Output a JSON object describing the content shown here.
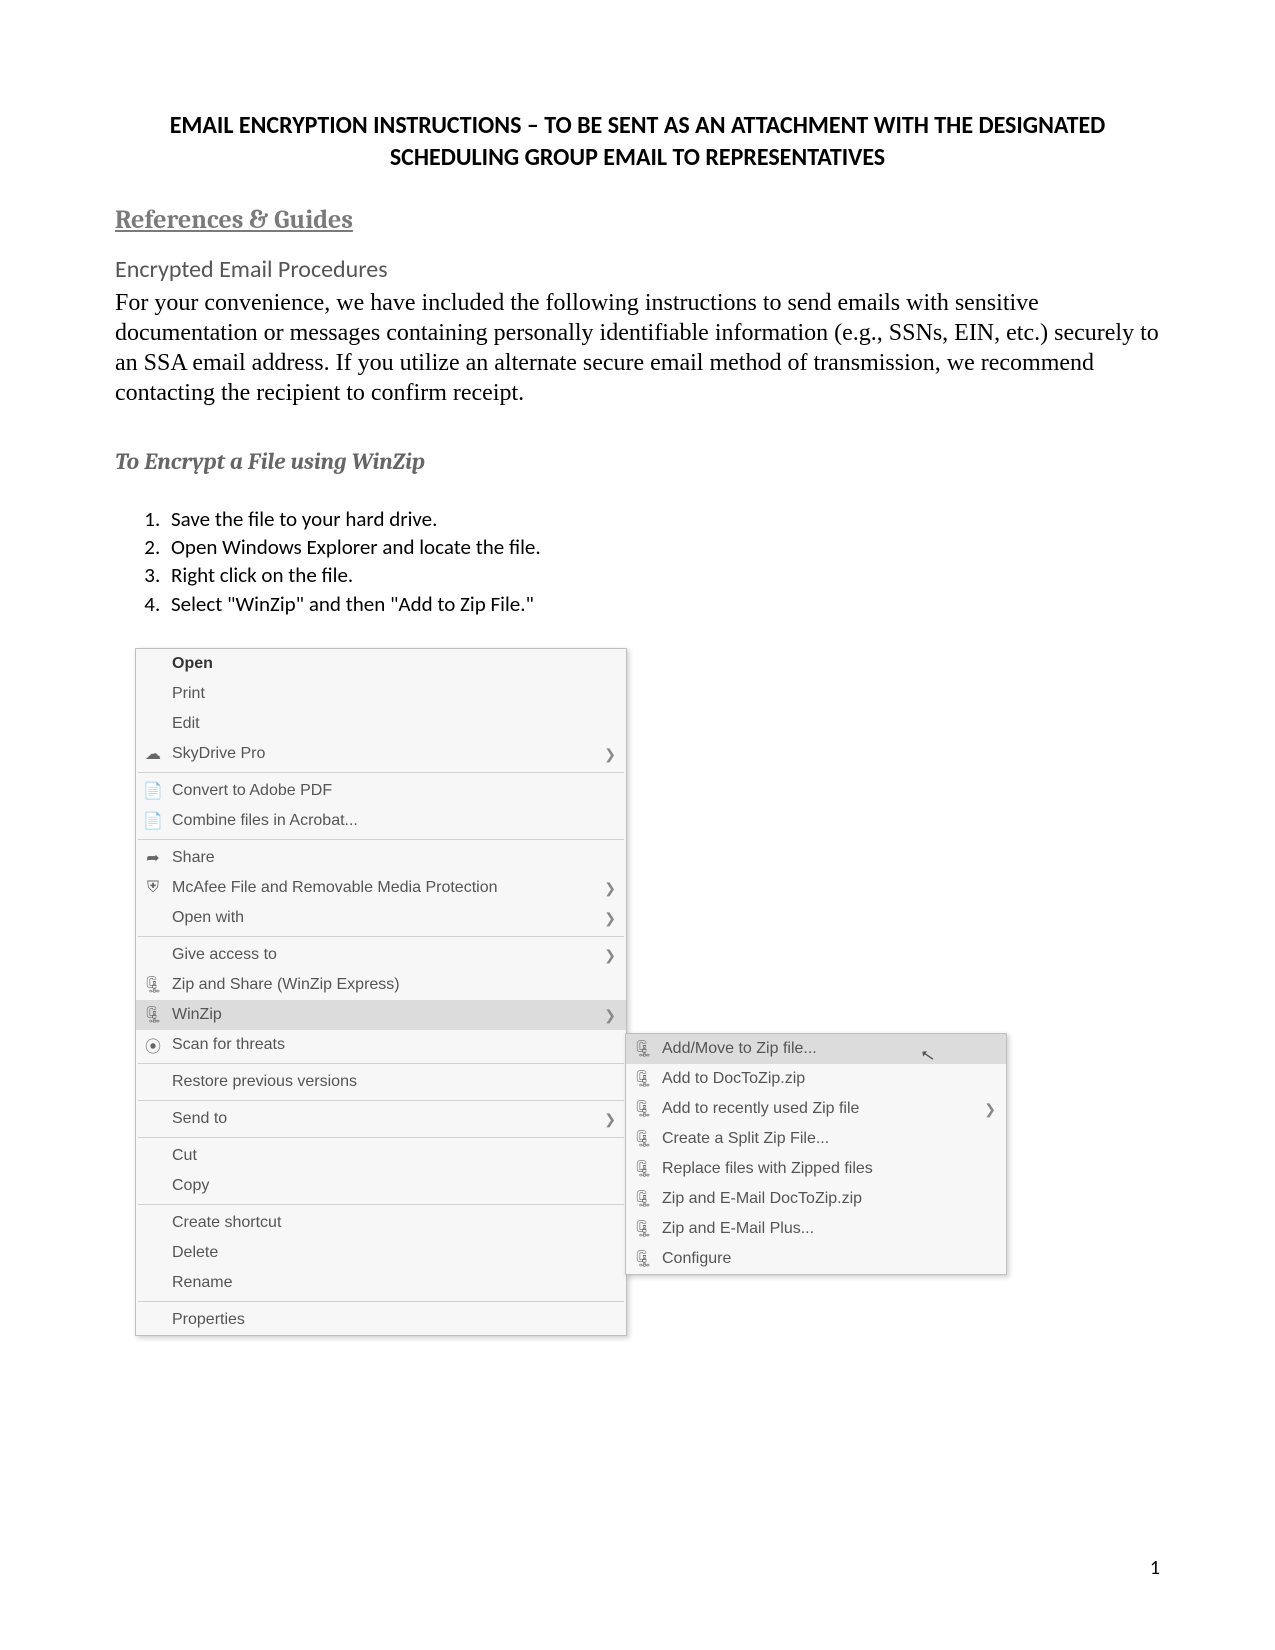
{
  "title": "EMAIL ENCRYPTION INSTRUCTIONS – TO BE SENT AS AN ATTACHMENT WITH THE DESIGNATED SCHEDULING GROUP EMAIL TO REPRESENTATIVES",
  "refs_heading": "References & Guides",
  "subheading": "Encrypted Email Procedures",
  "body": "For your convenience, we have included the following instructions to send emails with sensitive documentation or messages containing personally identifiable information (e.g., SSNs, EIN, etc.) securely to an SSA email address. If you utilize an alternate secure email method of transmission, we recommend contacting the recipient to confirm receipt.",
  "section_title": "To Encrypt a File using WinZip",
  "steps": [
    "Save the file to your hard drive.",
    "Open Windows Explorer and locate the file.",
    "Right click on the file.",
    "Select \"WinZip\" and then \"Add to Zip File.\""
  ],
  "context_menu": {
    "groups": [
      [
        {
          "label": "Open",
          "bold": true
        },
        {
          "label": "Print"
        },
        {
          "label": "Edit"
        },
        {
          "label": "SkyDrive Pro",
          "icon": "cloud",
          "arrow": true
        }
      ],
      [
        {
          "label": "Convert to Adobe PDF",
          "icon": "pdf"
        },
        {
          "label": "Combine files in Acrobat...",
          "icon": "pdf"
        }
      ],
      [
        {
          "label": "Share",
          "icon": "share"
        },
        {
          "label": "McAfee File and Removable Media Protection",
          "icon": "shield",
          "arrow": true
        },
        {
          "label": "Open with",
          "arrow": true
        }
      ],
      [
        {
          "label": "Give access to",
          "arrow": true
        },
        {
          "label": "Zip and Share (WinZip Express)",
          "icon": "zip"
        },
        {
          "label": "WinZip",
          "icon": "zip",
          "arrow": true,
          "highlight": true
        },
        {
          "label": "Scan for threats",
          "icon": "scan"
        }
      ],
      [
        {
          "label": "Restore previous versions"
        }
      ],
      [
        {
          "label": "Send to",
          "arrow": true
        }
      ],
      [
        {
          "label": "Cut"
        },
        {
          "label": "Copy"
        }
      ],
      [
        {
          "label": "Create shortcut"
        },
        {
          "label": "Delete"
        },
        {
          "label": "Rename"
        }
      ],
      [
        {
          "label": "Properties"
        }
      ]
    ]
  },
  "submenu": [
    {
      "label": "Add/Move to Zip file...",
      "icon": "zip",
      "highlight": true,
      "cursor": true
    },
    {
      "label": "Add to DocToZip.zip",
      "icon": "zip"
    },
    {
      "label": "Add to recently used Zip file",
      "icon": "zip",
      "arrow": true
    },
    {
      "label": "Create a Split Zip File...",
      "icon": "zip"
    },
    {
      "label": "Replace files with Zipped files",
      "icon": "zip"
    },
    {
      "label": "Zip and E-Mail DocToZip.zip",
      "icon": "zip"
    },
    {
      "label": "Zip and E-Mail Plus...",
      "icon": "zip"
    },
    {
      "label": "Configure",
      "icon": "zip"
    }
  ],
  "page_number": "1"
}
